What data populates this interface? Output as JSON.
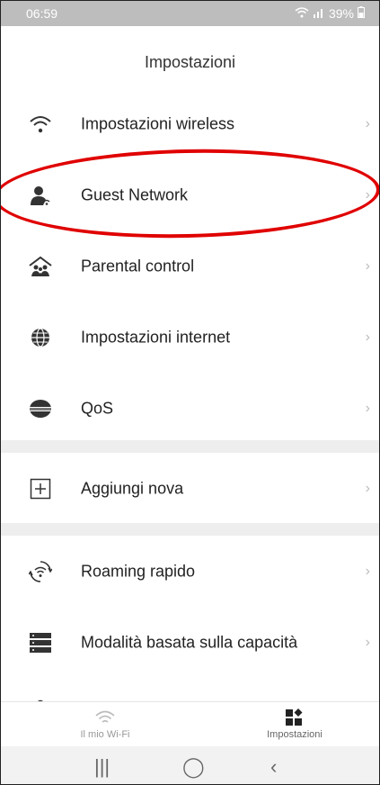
{
  "status": {
    "time": "06:59",
    "battery": "39%"
  },
  "header": {
    "title": "Impostazioni"
  },
  "rows": [
    {
      "label": "Impostazioni wireless",
      "icon": "wifi-icon"
    },
    {
      "label": "Guest Network",
      "icon": "guest-user-icon"
    },
    {
      "label": "Parental control",
      "icon": "family-home-icon"
    },
    {
      "label": "Impostazioni internet",
      "icon": "globe-icon"
    },
    {
      "label": "QoS",
      "icon": "qos-icon"
    },
    {
      "label": "Aggiungi nova",
      "icon": "add-square-icon"
    },
    {
      "label": "Roaming rapido",
      "icon": "roaming-wifi-icon"
    },
    {
      "label": "Modalità basata sulla capacità",
      "icon": "server-rack-icon"
    }
  ],
  "bottom_nav": [
    {
      "label": "Il mio Wi-Fi",
      "icon": "wifi-icon"
    },
    {
      "label": "Impostazioni",
      "icon": "settings-grid-icon"
    }
  ],
  "colors": {
    "highlight": "#e00000",
    "statusbar": "#bdbdbd"
  }
}
